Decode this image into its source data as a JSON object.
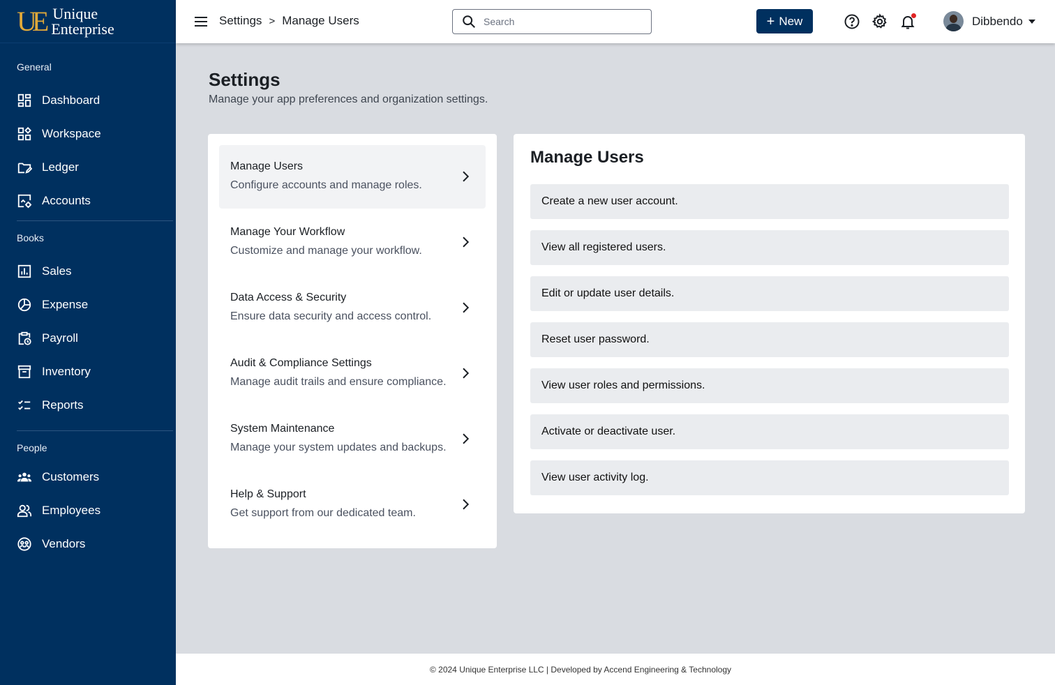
{
  "brand": {
    "mark": "UE",
    "line1": "Unique",
    "line2": "Enterprise",
    "mark_color": "#e0a93a"
  },
  "colors": {
    "primary": "#00305f",
    "background": "#d9dce1",
    "notification": "#e02424"
  },
  "sidebar": {
    "sections": [
      {
        "heading": "General",
        "items": [
          {
            "label": "Dashboard",
            "icon": "dashboard-icon"
          },
          {
            "label": "Workspace",
            "icon": "workspace-icon"
          },
          {
            "label": "Ledger",
            "icon": "ledger-icon"
          },
          {
            "label": "Accounts",
            "icon": "accounts-icon"
          }
        ]
      },
      {
        "heading": "Books",
        "items": [
          {
            "label": "Sales",
            "icon": "sales-chart-icon"
          },
          {
            "label": "Expense",
            "icon": "expense-pie-icon"
          },
          {
            "label": "Payroll",
            "icon": "payroll-icon"
          },
          {
            "label": "Inventory",
            "icon": "inventory-icon"
          },
          {
            "label": "Reports",
            "icon": "reports-checklist-icon"
          }
        ]
      },
      {
        "heading": "People",
        "items": [
          {
            "label": "Customers",
            "icon": "customers-icon"
          },
          {
            "label": "Employees",
            "icon": "employees-icon"
          },
          {
            "label": "Vendors",
            "icon": "vendors-icon"
          }
        ]
      }
    ]
  },
  "topbar": {
    "breadcrumb": [
      "Settings",
      "Manage Users"
    ],
    "breadcrumb_separator": ">",
    "search_placeholder": "Search",
    "new_button": "New",
    "user_name": "Dibbendo"
  },
  "page": {
    "title": "Settings",
    "subtitle": "Manage your app preferences and organization settings."
  },
  "settings_menu": [
    {
      "title": "Manage Users",
      "desc": "Configure accounts and manage roles.",
      "active": true
    },
    {
      "title": "Manage Your Workflow",
      "desc": "Customize and manage your workflow."
    },
    {
      "title": "Data Access & Security",
      "desc": "Ensure data security and access control."
    },
    {
      "title": "Audit & Compliance Settings",
      "desc": "Manage audit trails and ensure compliance."
    },
    {
      "title": "System Maintenance",
      "desc": "Manage your system updates and backups."
    },
    {
      "title": "Help & Support",
      "desc": "Get support from our dedicated team."
    }
  ],
  "manage_users": {
    "title": "Manage Users",
    "actions": [
      "Create a new user account.",
      "View all registered users.",
      "Edit or update user details.",
      "Reset user password.",
      "View user roles and permissions.",
      "Activate or deactivate user.",
      "View user activity log."
    ]
  },
  "footer": {
    "text": "© 2024 Unique Enterprise LLC | Developed by Accend Engineering & Technology"
  }
}
